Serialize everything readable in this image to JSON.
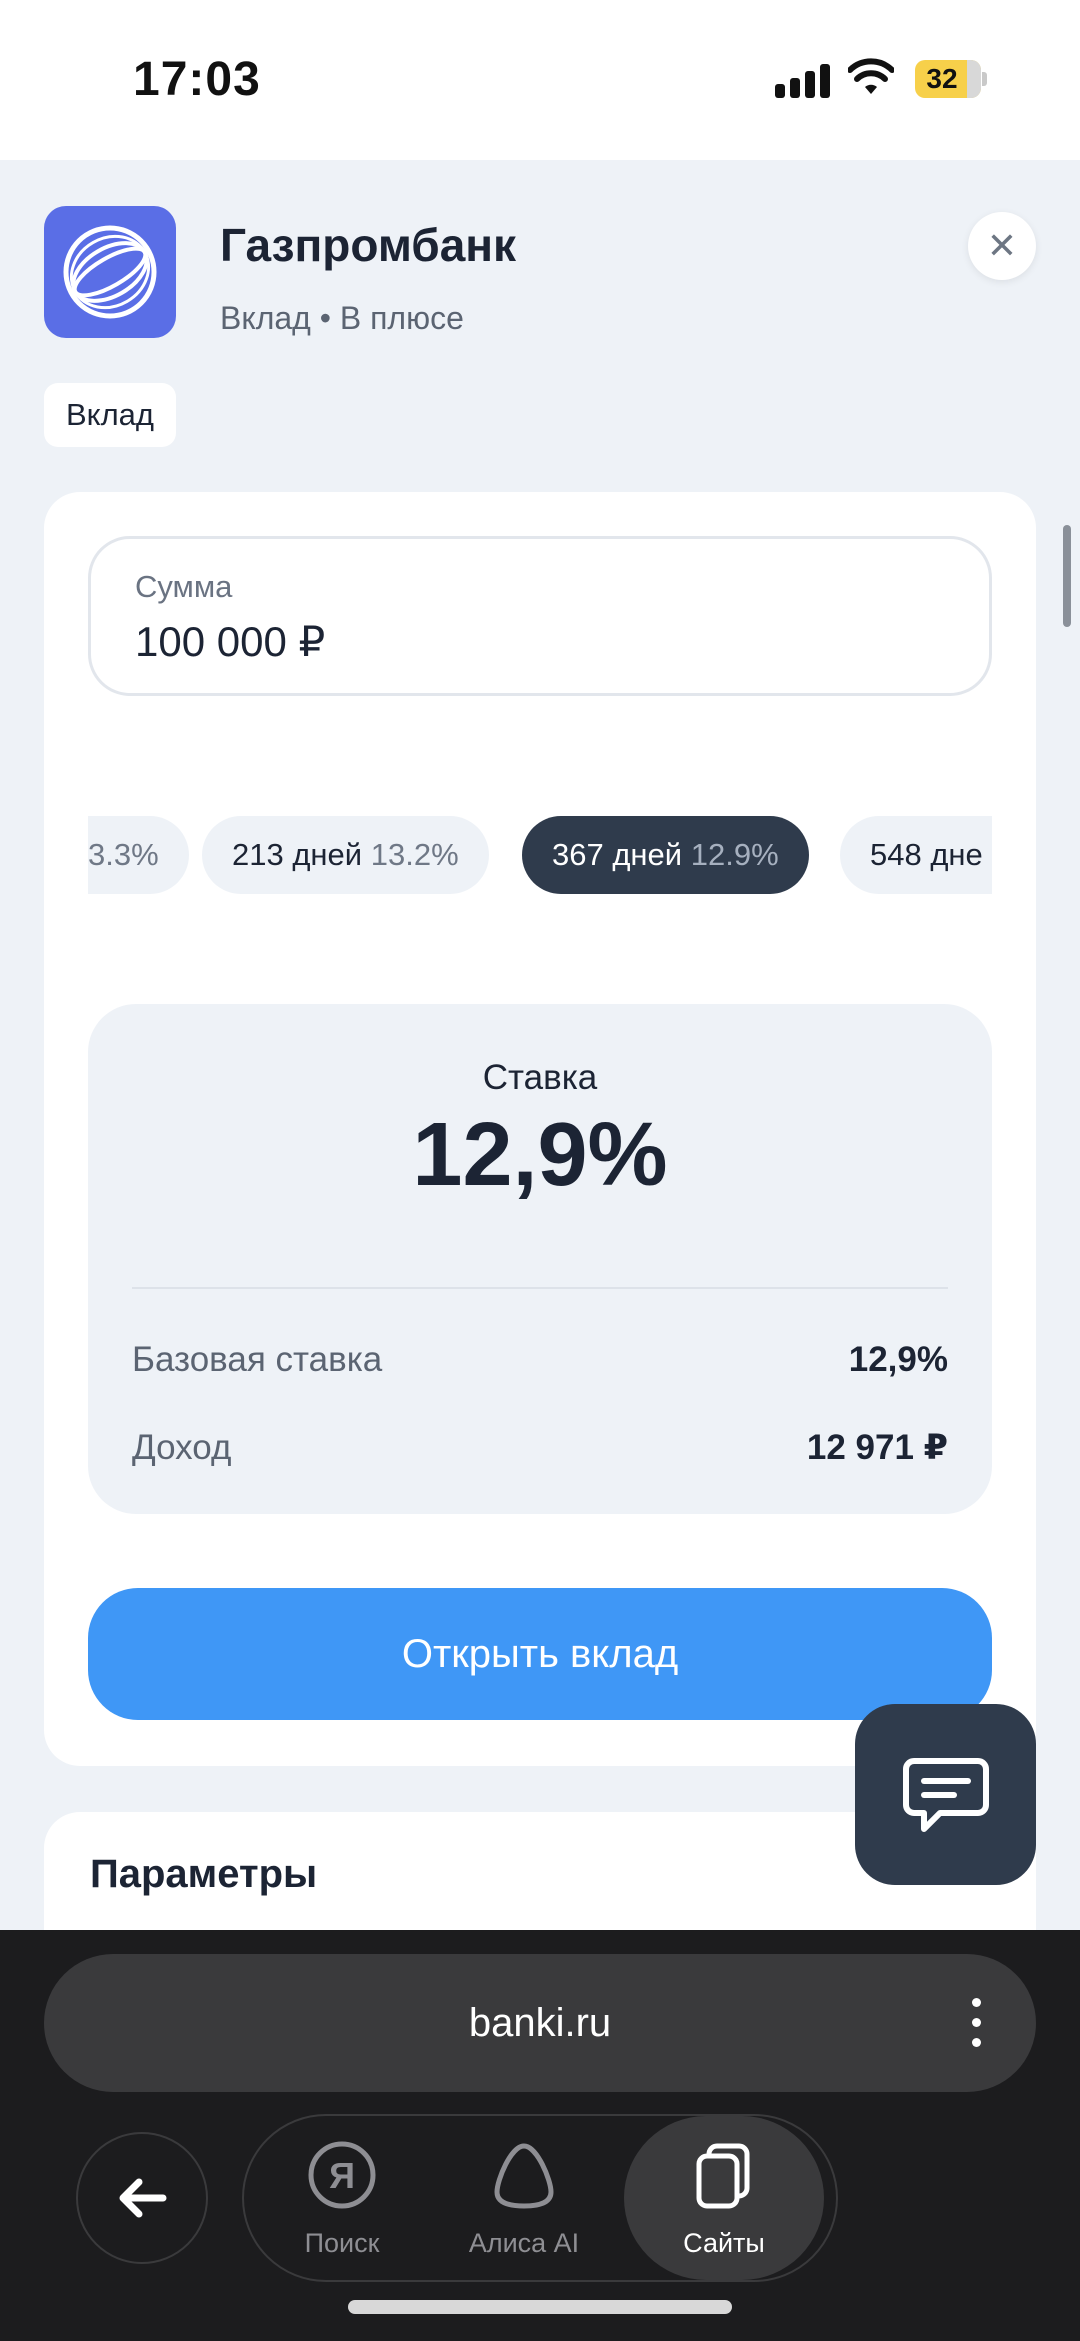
{
  "status_bar": {
    "time": "17:03",
    "battery": "32"
  },
  "bank": {
    "name": "Газпромбанк",
    "subtitle": "Вклад • В плюсе",
    "tag": "Вклад"
  },
  "deposit": {
    "sum_label": "Сумма",
    "sum_value": "100 000 ₽",
    "terms": [
      {
        "days": "",
        "rate": "3.3%"
      },
      {
        "days": "213 дней",
        "rate": "13.2%"
      },
      {
        "days": "367 дней",
        "rate": "12.9%",
        "active": true
      },
      {
        "days": "548 дне",
        "rate": ""
      }
    ],
    "rate_title": "Ставка",
    "rate_value": "12,9%",
    "base_rate_label": "Базовая ставка",
    "base_rate_value": "12,9%",
    "income_label": "Доход",
    "income_value": "12 971 ₽",
    "open_button": "Открыть вклад"
  },
  "params": {
    "title": "Параметры"
  },
  "browser": {
    "url": "banki.ru",
    "nav": [
      {
        "label": "Поиск",
        "icon": "yandex-icon"
      },
      {
        "label": "Алиса AI",
        "icon": "alice-icon"
      },
      {
        "label": "Сайты",
        "icon": "tabs-icon",
        "active": true
      }
    ]
  },
  "colors": {
    "accent": "#3f97f6",
    "dark_chip": "#2f3b4c",
    "logo": "#5a6ee6",
    "battery": "#f7d04a"
  }
}
